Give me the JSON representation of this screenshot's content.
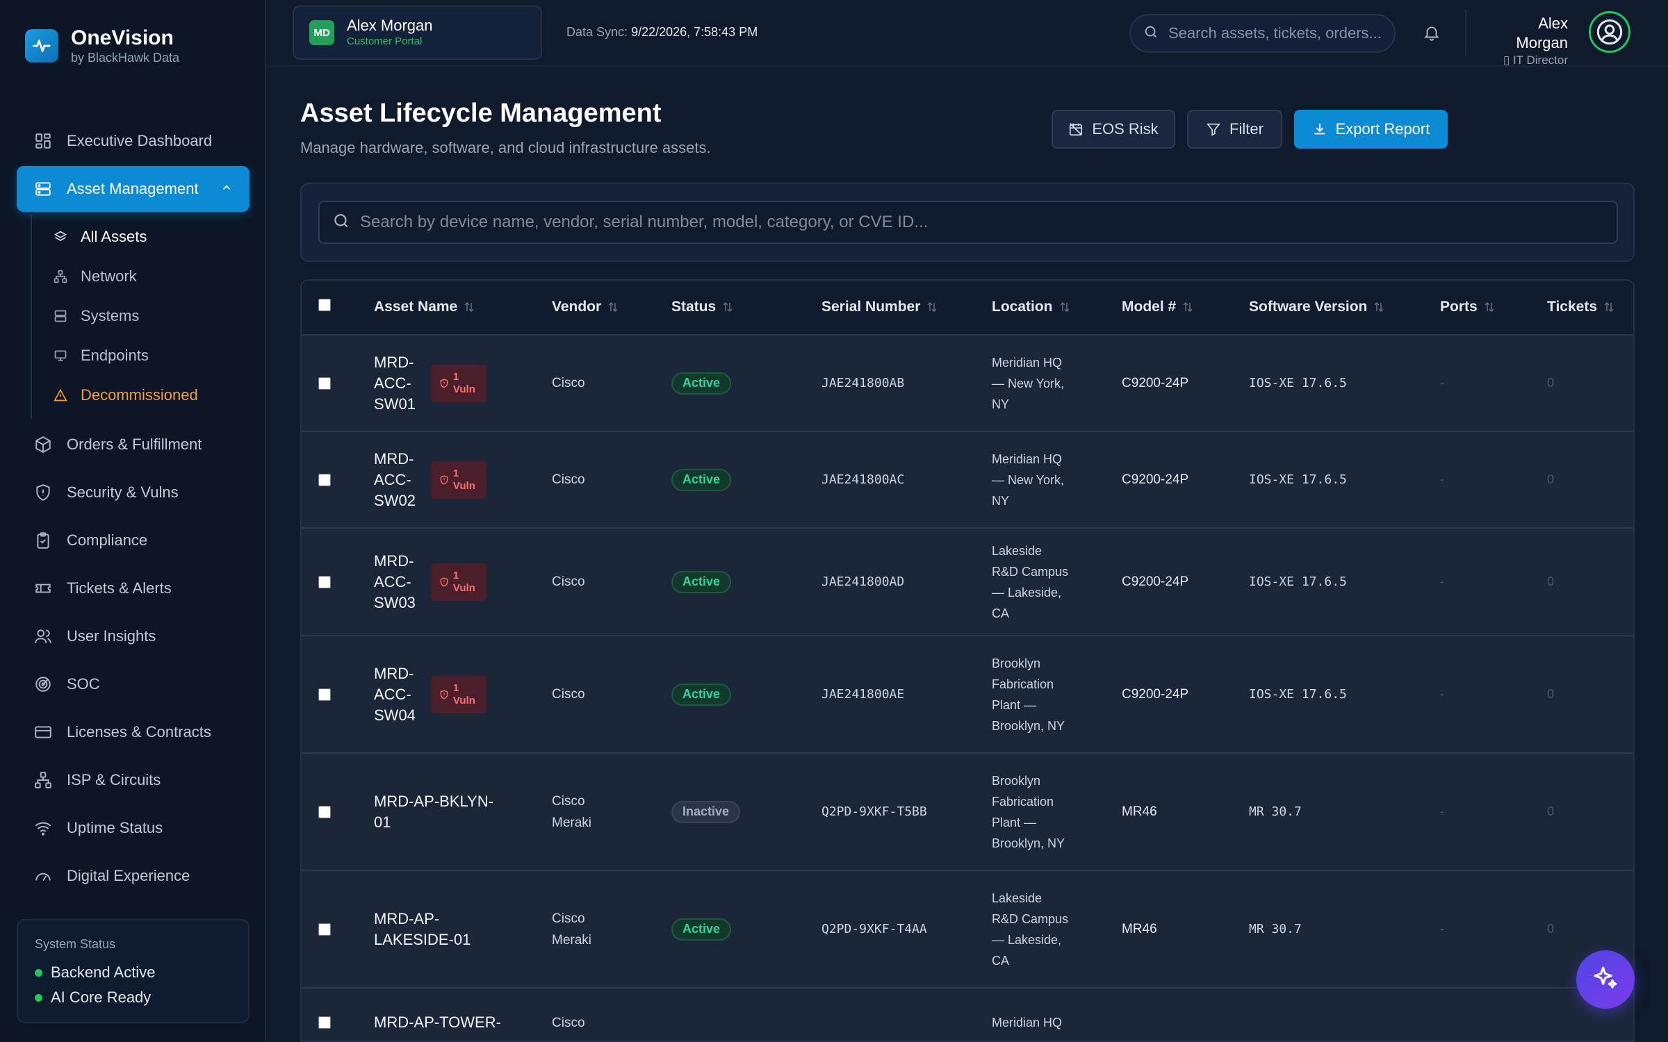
{
  "brand": {
    "name": "OneVision",
    "sub": "by BlackHawk Data"
  },
  "nav": {
    "items_top": [
      {
        "label": "Executive Dashboard",
        "icon": "dashboard-icon"
      }
    ],
    "asset_management": {
      "label": "Asset Management",
      "icon": "server-icon"
    },
    "sub_items": [
      {
        "label": "All Assets",
        "icon": "layers-icon"
      },
      {
        "label": "Network",
        "icon": "network-icon"
      },
      {
        "label": "Systems",
        "icon": "database-icon"
      },
      {
        "label": "Endpoints",
        "icon": "monitor-icon"
      },
      {
        "label": "Decommissioned",
        "icon": "warning-icon"
      }
    ],
    "items_bottom": [
      {
        "label": "Orders & Fulfillment",
        "icon": "package-icon"
      },
      {
        "label": "Security & Vulns",
        "icon": "shield-icon"
      },
      {
        "label": "Compliance",
        "icon": "clipboard-check-icon"
      },
      {
        "label": "Tickets & Alerts",
        "icon": "ticket-icon"
      },
      {
        "label": "User Insights",
        "icon": "users-icon"
      },
      {
        "label": "SOC",
        "icon": "radar-icon"
      },
      {
        "label": "Licenses & Contracts",
        "icon": "credit-card-icon"
      },
      {
        "label": "ISP & Circuits",
        "icon": "network-tree-icon"
      },
      {
        "label": "Uptime Status",
        "icon": "wifi-icon"
      },
      {
        "label": "Digital Experience",
        "icon": "gauge-icon"
      }
    ]
  },
  "system_status": {
    "title": "System Status",
    "backend": "Backend Active",
    "ai": "AI Core Ready"
  },
  "topbar": {
    "portal_initials": "MD",
    "portal_name": "Alex Morgan",
    "portal_sub": "Customer Portal",
    "sync_label": "Data Sync:",
    "sync_value": "9/22/2026, 7:58:43 PM",
    "search_placeholder": "Search assets, tickets, orders...",
    "user_name": "Alex Morgan",
    "user_role": "IT Director"
  },
  "page": {
    "title": "Asset Lifecycle Management",
    "subtitle": "Manage hardware, software, and cloud infrastructure assets.",
    "eos_label": "EOS Risk",
    "filter_label": "Filter",
    "export_label": "Export Report",
    "search_placeholder": "Search by device name, vendor, serial number, model, category, or CVE ID..."
  },
  "table": {
    "headers": {
      "name": "Asset Name",
      "vendor": "Vendor",
      "status": "Status",
      "serial": "Serial Number",
      "location": "Location",
      "model": "Model #",
      "software": "Software Version",
      "ports": "Ports",
      "tickets": "Tickets"
    },
    "rows": [
      {
        "name": [
          "MRD-",
          "ACC-",
          "SW01"
        ],
        "vuln": [
          "1",
          "Vuln"
        ],
        "vendor": [
          "Cisco"
        ],
        "status": "Active",
        "serial": "JAE241800AB",
        "location": [
          "Meridian HQ",
          "— New York,",
          "NY"
        ],
        "model": "C9200-24P",
        "software": "IOS-XE 17.6.5",
        "ports": "-",
        "tickets": "0"
      },
      {
        "name": [
          "MRD-",
          "ACC-",
          "SW02"
        ],
        "vuln": [
          "1",
          "Vuln"
        ],
        "vendor": [
          "Cisco"
        ],
        "status": "Active",
        "serial": "JAE241800AC",
        "location": [
          "Meridian HQ",
          "— New York,",
          "NY"
        ],
        "model": "C9200-24P",
        "software": "IOS-XE 17.6.5",
        "ports": "-",
        "tickets": "0"
      },
      {
        "name": [
          "MRD-",
          "ACC-",
          "SW03"
        ],
        "vuln": [
          "1",
          "Vuln"
        ],
        "vendor": [
          "Cisco"
        ],
        "status": "Active",
        "serial": "JAE241800AD",
        "location": [
          "Lakeside",
          "R&D Campus",
          "— Lakeside,",
          "CA"
        ],
        "model": "C9200-24P",
        "software": "IOS-XE 17.6.5",
        "ports": "-",
        "tickets": "0"
      },
      {
        "name": [
          "MRD-",
          "ACC-",
          "SW04"
        ],
        "vuln": [
          "1",
          "Vuln"
        ],
        "vendor": [
          "Cisco"
        ],
        "status": "Active",
        "serial": "JAE241800AE",
        "location": [
          "Brooklyn",
          "Fabrication",
          "Plant —",
          "Brooklyn, NY"
        ],
        "model": "C9200-24P",
        "software": "IOS-XE 17.6.5",
        "ports": "-",
        "tickets": "0"
      },
      {
        "name": [
          "MRD-AP-BKLYN-",
          "01"
        ],
        "vuln": null,
        "vendor": [
          "Cisco",
          "Meraki"
        ],
        "status": "Inactive",
        "serial": "Q2PD-9XKF-T5BB",
        "location": [
          "Brooklyn",
          "Fabrication",
          "Plant —",
          "Brooklyn, NY"
        ],
        "model": "MR46",
        "software": "MR 30.7",
        "ports": "-",
        "tickets": "0"
      },
      {
        "name": [
          "MRD-AP-",
          "LAKESIDE-01"
        ],
        "vuln": null,
        "vendor": [
          "Cisco",
          "Meraki"
        ],
        "status": "Active",
        "serial": "Q2PD-9XKF-T4AA",
        "location": [
          "Lakeside",
          "R&D Campus",
          "— Lakeside,",
          "CA"
        ],
        "model": "MR46",
        "software": "MR 30.7",
        "ports": "-",
        "tickets": "0"
      },
      {
        "name": [
          "MRD-AP-TOWER-"
        ],
        "vuln": null,
        "vendor": [
          "Cisco"
        ],
        "status": "",
        "serial": "",
        "location": [
          "Meridian HQ"
        ],
        "model": "",
        "software": "",
        "ports": "",
        "tickets": ""
      }
    ]
  },
  "colors": {
    "accent": "#0c8ad4",
    "success": "#22c55e",
    "warning": "#f59e3b",
    "danger": "#f87171"
  }
}
